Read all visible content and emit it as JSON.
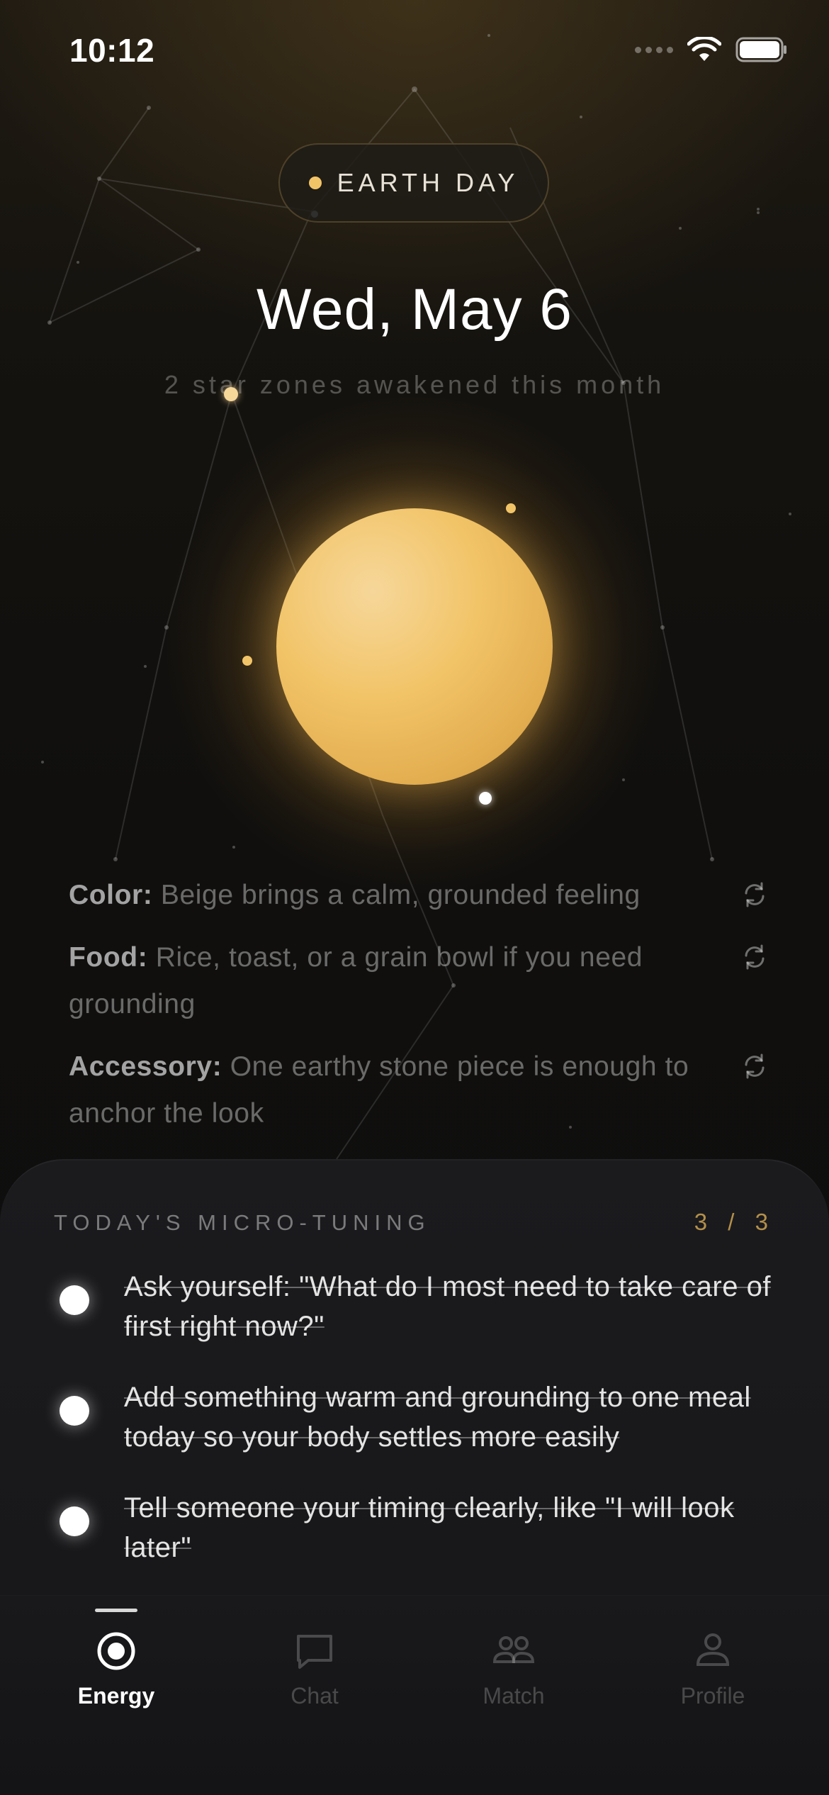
{
  "status_bar": {
    "time": "10:12"
  },
  "header": {
    "pill_label": "EARTH DAY",
    "date_title": "Wed, May 6",
    "subtitle": "2 star zones awakened this month"
  },
  "tips": [
    {
      "key": "Color:",
      "text": "Beige brings a calm, grounded feeling"
    },
    {
      "key": "Food:",
      "text": "Rice, toast, or a grain bowl if you need grounding"
    },
    {
      "key": "Accessory:",
      "text": "One earthy stone piece is enough to anchor the look"
    }
  ],
  "micro_tuning": {
    "title": "TODAY'S MICRO-TUNING",
    "count": "3 / 3",
    "tasks": [
      {
        "text": "Ask yourself: \"What do I most need to take care of first right now?\"",
        "done": true
      },
      {
        "text": "Add something warm and grounding to one meal today so your body settles more easily",
        "done": true
      },
      {
        "text": "Tell someone your timing clearly, like \"I will look later\"",
        "done": true
      }
    ]
  },
  "tabbar": {
    "tabs": [
      {
        "label": "Energy",
        "icon": "energy-icon",
        "active": true
      },
      {
        "label": "Chat",
        "icon": "chat-icon",
        "active": false
      },
      {
        "label": "Match",
        "icon": "match-icon",
        "active": false
      },
      {
        "label": "Profile",
        "icon": "profile-icon",
        "active": false
      }
    ]
  },
  "colors": {
    "accent_gold": "#f2c468",
    "count_gold": "#b4904a",
    "background": "#0f0e0d"
  }
}
